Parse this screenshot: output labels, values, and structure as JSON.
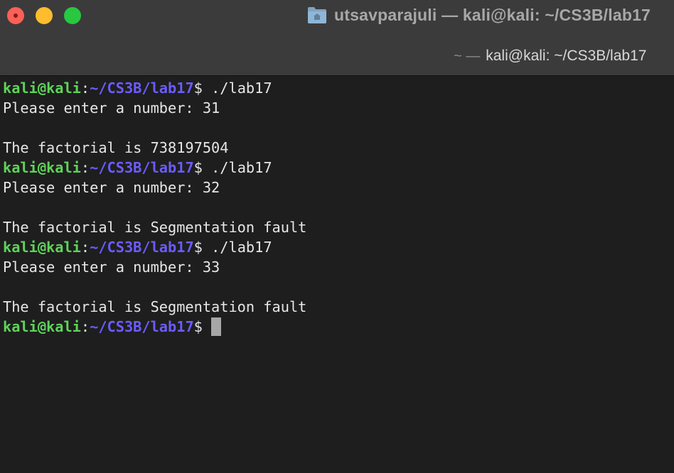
{
  "window": {
    "title": "utsavparajuli — kali@kali: ~/CS3B/lab17",
    "tab_prefix": "~ —",
    "tab_title": "kali@kali: ~/CS3B/lab17"
  },
  "colors": {
    "background": "#1e1e1e",
    "titlebar": "#3b3b3b",
    "user": "#5fd35a",
    "path": "#6b5cff",
    "text": "#e6e6e6",
    "close": "#fe5f57",
    "minimize": "#febc2e",
    "maximize": "#28c840"
  },
  "icons": {
    "window_icon": "folder-icon"
  },
  "terminal": {
    "prompt_user": "kali@kali",
    "prompt_colon": ":",
    "prompt_path": "~/CS3B/lab17",
    "prompt_symbol": "$ ",
    "lines": [
      {
        "type": "prompt",
        "command": "./lab17"
      },
      {
        "type": "output",
        "text": "Please enter a number: 31"
      },
      {
        "type": "output",
        "text": ""
      },
      {
        "type": "output",
        "text": "The factorial is 738197504"
      },
      {
        "type": "prompt",
        "command": "./lab17"
      },
      {
        "type": "output",
        "text": "Please enter a number: 32"
      },
      {
        "type": "output",
        "text": ""
      },
      {
        "type": "output",
        "text": "The factorial is Segmentation fault"
      },
      {
        "type": "prompt",
        "command": "./lab17"
      },
      {
        "type": "output",
        "text": "Please enter a number: 33"
      },
      {
        "type": "output",
        "text": ""
      },
      {
        "type": "output",
        "text": "The factorial is Segmentation fault"
      },
      {
        "type": "prompt",
        "command": "",
        "cursor": true
      }
    ]
  }
}
